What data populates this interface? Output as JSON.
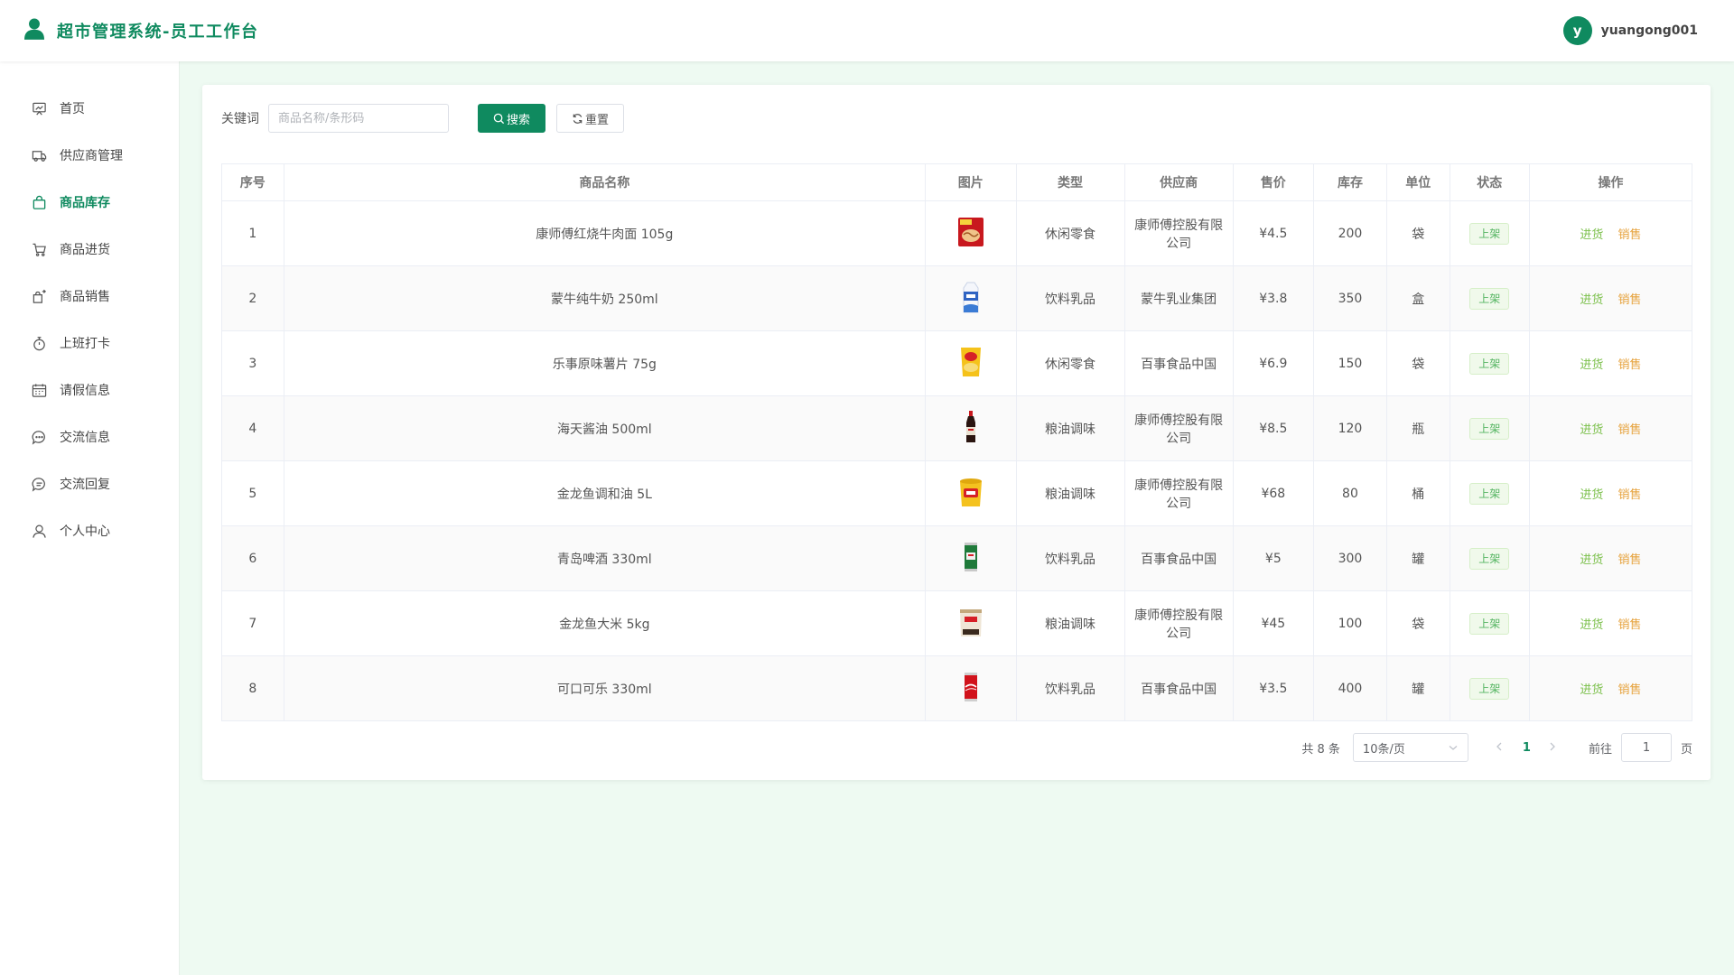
{
  "app": {
    "title": "超市管理系统-员工工作台"
  },
  "user": {
    "avatar_letter": "y",
    "name": "yuangong001"
  },
  "theme": {
    "primary": "#0f8a5f",
    "tag_green": "#55b562",
    "op_in": "#7cc04c",
    "op_out": "#e6a23c"
  },
  "sidebar": {
    "items": [
      {
        "label": "首页",
        "icon": "home-icon",
        "active": false
      },
      {
        "label": "供应商管理",
        "icon": "truck-icon",
        "active": false
      },
      {
        "label": "商品库存",
        "icon": "bag-icon",
        "active": true
      },
      {
        "label": "商品进货",
        "icon": "cart-icon",
        "active": false
      },
      {
        "label": "商品销售",
        "icon": "sell-icon",
        "active": false
      },
      {
        "label": "上班打卡",
        "icon": "stopwatch-icon",
        "active": false
      },
      {
        "label": "请假信息",
        "icon": "calendar-icon",
        "active": false
      },
      {
        "label": "交流信息",
        "icon": "chat-icon",
        "active": false
      },
      {
        "label": "交流回复",
        "icon": "reply-icon",
        "active": false
      },
      {
        "label": "个人中心",
        "icon": "user-icon",
        "active": false
      }
    ]
  },
  "search": {
    "label": "关键词",
    "placeholder": "商品名称/条形码",
    "value": "",
    "search_btn": "搜索",
    "reset_btn": "重置"
  },
  "table": {
    "columns": [
      "序号",
      "商品名称",
      "图片",
      "类型",
      "供应商",
      "售价",
      "库存",
      "单位",
      "状态",
      "操作"
    ],
    "rows": [
      {
        "no": "1",
        "name": "康师傅红烧牛肉面 105g",
        "image": "instant-noodles",
        "type": "休闲零食",
        "supplier": "康师傅控股有限公司",
        "price": "¥4.5",
        "stock": "200",
        "unit": "袋",
        "status": "上架",
        "op_in": "进货",
        "op_out": "销售"
      },
      {
        "no": "2",
        "name": "蒙牛纯牛奶 250ml",
        "image": "milk-carton",
        "type": "饮料乳品",
        "supplier": "蒙牛乳业集团",
        "price": "¥3.8",
        "stock": "350",
        "unit": "盒",
        "status": "上架",
        "op_in": "进货",
        "op_out": "销售"
      },
      {
        "no": "3",
        "name": "乐事原味薯片 75g",
        "image": "potato-chips",
        "type": "休闲零食",
        "supplier": "百事食品中国",
        "price": "¥6.9",
        "stock": "150",
        "unit": "袋",
        "status": "上架",
        "op_in": "进货",
        "op_out": "销售"
      },
      {
        "no": "4",
        "name": "海天酱油 500ml",
        "image": "soy-sauce-bottle",
        "type": "粮油调味",
        "supplier": "康师傅控股有限公司",
        "price": "¥8.5",
        "stock": "120",
        "unit": "瓶",
        "status": "上架",
        "op_in": "进货",
        "op_out": "销售"
      },
      {
        "no": "5",
        "name": "金龙鱼调和油 5L",
        "image": "oil-bucket",
        "type": "粮油调味",
        "supplier": "康师傅控股有限公司",
        "price": "¥68",
        "stock": "80",
        "unit": "桶",
        "status": "上架",
        "op_in": "进货",
        "op_out": "销售"
      },
      {
        "no": "6",
        "name": "青岛啤酒 330ml",
        "image": "beer-can",
        "type": "饮料乳品",
        "supplier": "百事食品中国",
        "price": "¥5",
        "stock": "300",
        "unit": "罐",
        "status": "上架",
        "op_in": "进货",
        "op_out": "销售"
      },
      {
        "no": "7",
        "name": "金龙鱼大米 5kg",
        "image": "rice-bag",
        "type": "粮油调味",
        "supplier": "康师傅控股有限公司",
        "price": "¥45",
        "stock": "100",
        "unit": "袋",
        "status": "上架",
        "op_in": "进货",
        "op_out": "销售"
      },
      {
        "no": "8",
        "name": "可口可乐 330ml",
        "image": "cola-can",
        "type": "饮料乳品",
        "supplier": "百事食品中国",
        "price": "¥3.5",
        "stock": "400",
        "unit": "罐",
        "status": "上架",
        "op_in": "进货",
        "op_out": "销售"
      }
    ]
  },
  "pagination": {
    "total_text": "共 8 条",
    "page_size": "10条/页",
    "current_page": "1",
    "goto_prefix": "前往",
    "goto_value": "1",
    "goto_suffix": "页"
  }
}
